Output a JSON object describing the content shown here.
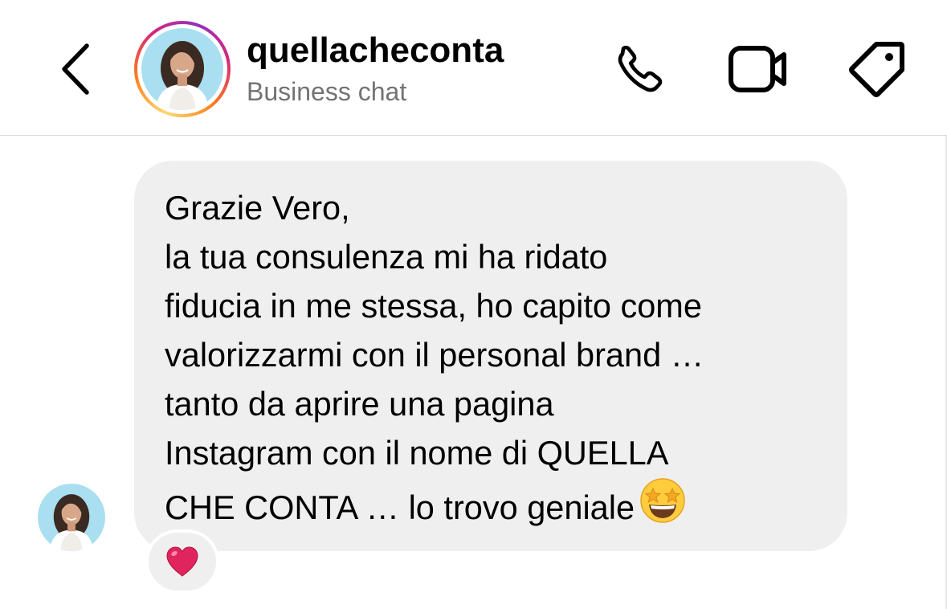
{
  "header": {
    "username": "quellacheconta",
    "subtitle": "Business chat",
    "back_icon": "chevron-left-icon",
    "phone_icon": "phone-icon",
    "video_icon": "video-camera-icon",
    "tag_icon": "tag-icon"
  },
  "message": {
    "lines": [
      "Grazie Vero,",
      "la tua consulenza mi ha ridato",
      "fiducia in me stessa, ho capito come",
      "valorizzarmi con il personal brand …",
      "tanto da aprire una pagina",
      "Instagram con il nome di QUELLA",
      "CHE CONTA … lo trovo geniale"
    ],
    "trailing_emoji": "star-struck-emoji",
    "reaction": "red-heart-emoji"
  },
  "colors": {
    "bubble": "#efefef",
    "subtitle": "#737373",
    "divider": "#dbdbdb",
    "heart": "#e0245e"
  }
}
